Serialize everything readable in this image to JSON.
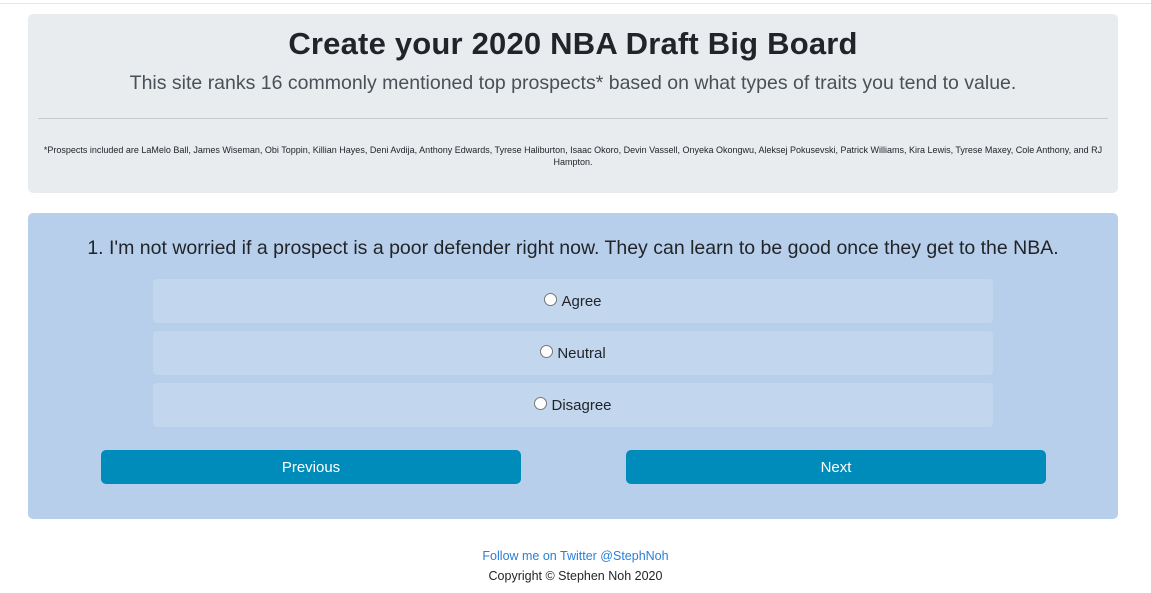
{
  "header": {
    "title": "Create your 2020 NBA Draft Big Board",
    "subtitle": "This site ranks 16 commonly mentioned top prospects* based on what types of traits you tend to value.",
    "footnote": "*Prospects included are LaMelo Ball, James Wiseman, Obi Toppin, Killian Hayes, Deni Avdija, Anthony Edwards, Tyrese Haliburton, Isaac Okoro, Devin Vassell, Onyeka Okongwu, Aleksej Pokusevski, Patrick Williams, Kira Lewis, Tyrese Maxey, Cole Anthony, and RJ Hampton."
  },
  "quiz": {
    "question": "1. I'm not worried if a prospect is a poor defender right now. They can learn to be good once they get to the NBA.",
    "options": [
      {
        "label": "Agree",
        "selected": false
      },
      {
        "label": "Neutral",
        "selected": false
      },
      {
        "label": "Disagree",
        "selected": false
      }
    ],
    "previous_label": "Previous",
    "next_label": "Next"
  },
  "footer": {
    "twitter_link": "Follow me on Twitter @StephNoh",
    "copyright": "Copyright © Stephen Noh 2020"
  },
  "colors": {
    "jumbotron_bg": "#e9ecef",
    "quiz_bg": "#b8cfeb",
    "option_bg": "#c2d6ee",
    "button_bg": "#008cba",
    "link": "#2a7fd4"
  }
}
